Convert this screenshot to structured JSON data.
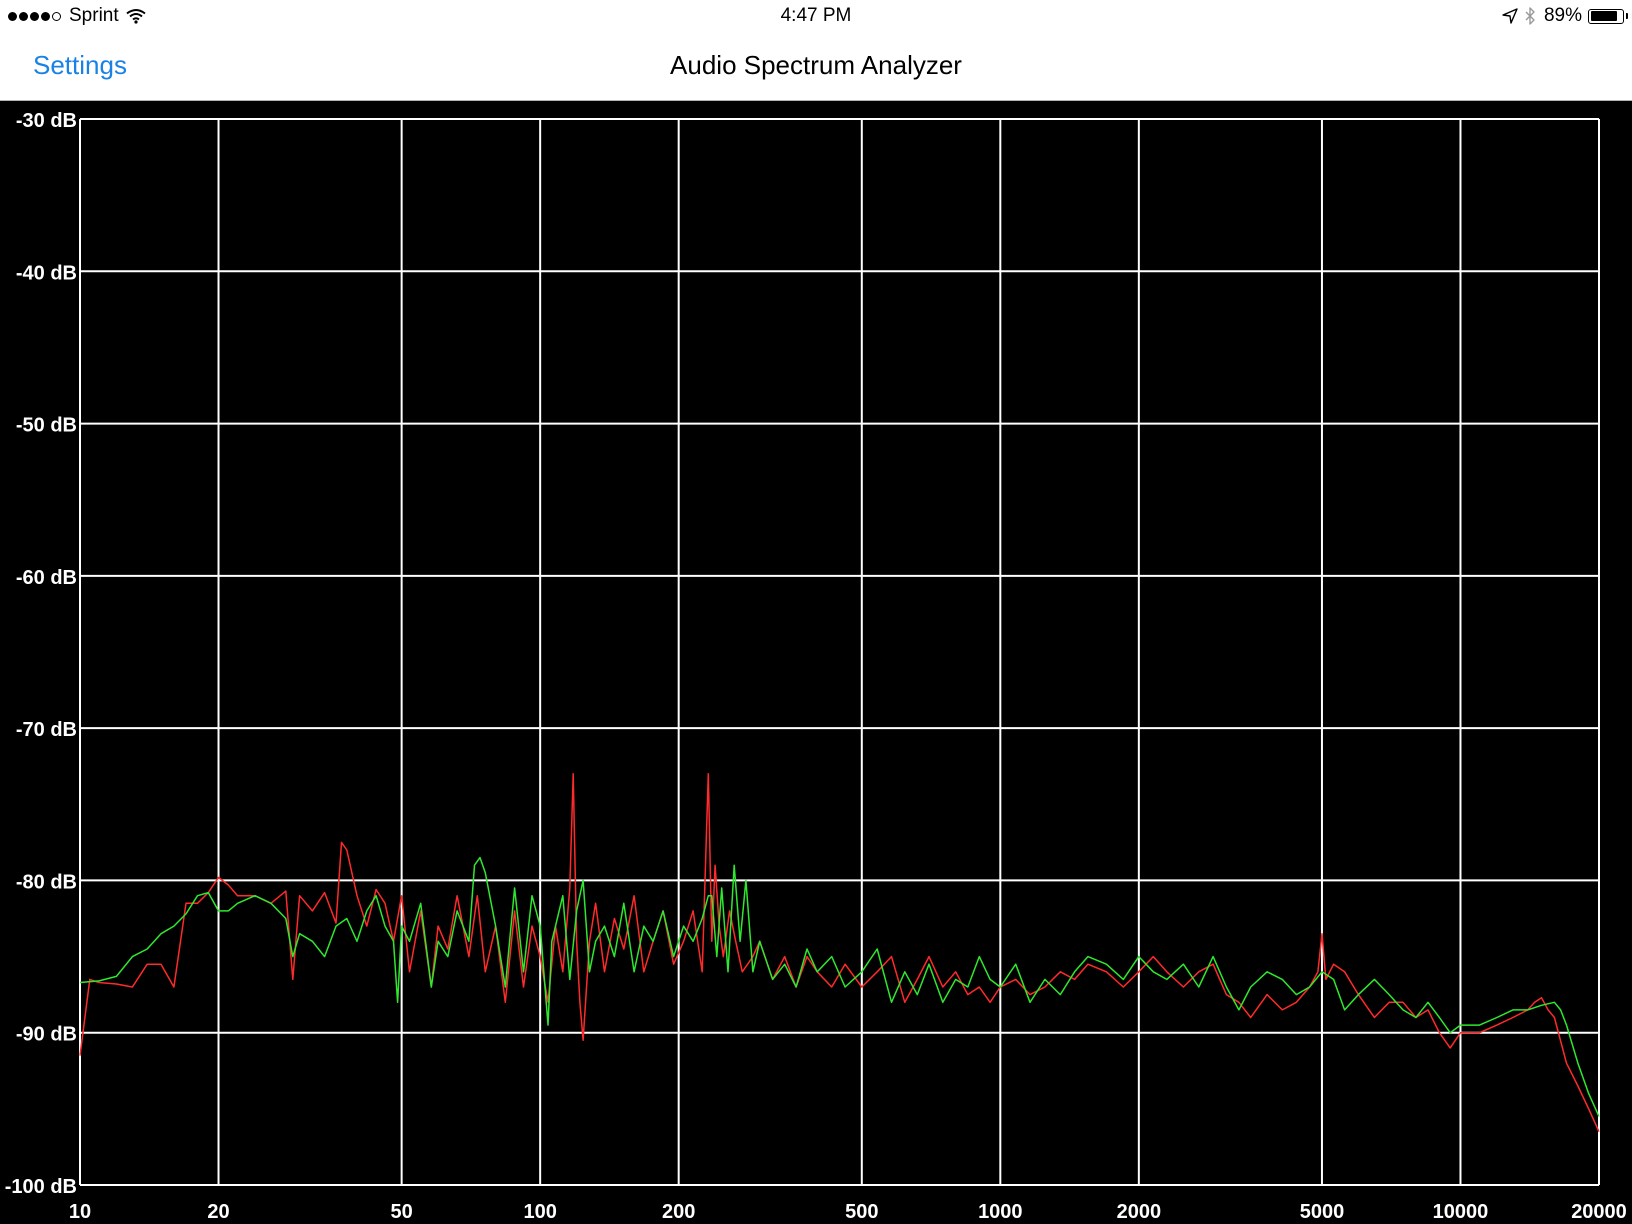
{
  "status_bar": {
    "signal_bars_filled": 4,
    "signal_bars_total": 5,
    "carrier": "Sprint",
    "wifi_icon": "wifi-icon",
    "time": "4:47 PM",
    "location_icon": "location-arrow-icon",
    "bluetooth_icon": "bluetooth-icon",
    "battery_percent": "89%",
    "battery_level": 0.89
  },
  "nav_bar": {
    "back_label": "Settings",
    "title": "Audio Spectrum Analyzer",
    "accent_color": "#1a82e6"
  },
  "chart_data": {
    "type": "line",
    "xscale": "log",
    "xlim": [
      10,
      20000
    ],
    "ylim": [
      -100,
      -30
    ],
    "grid": true,
    "background": "#000000",
    "grid_color": "#ffffff",
    "x_ticks": [
      10,
      20,
      50,
      100,
      200,
      500,
      1000,
      2000,
      5000,
      10000,
      20000
    ],
    "x_tick_labels": [
      "10",
      "20",
      "50",
      "100",
      "200",
      "500",
      "1000",
      "2000",
      "5000",
      "10000",
      "20000"
    ],
    "y_ticks": [
      -30,
      -40,
      -50,
      -60,
      -70,
      -80,
      -90,
      -100
    ],
    "y_tick_labels": [
      "-30 dB",
      "-40 dB",
      "-50 dB",
      "-60 dB",
      "-70 dB",
      "-80 dB",
      "-90 dB",
      "-100 dB"
    ],
    "series": [
      {
        "color": "#ff2a2a",
        "x": [
          10,
          10.5,
          11,
          12,
          13,
          14,
          15,
          16,
          17,
          18,
          19,
          20,
          21,
          22,
          24,
          26,
          28,
          29,
          30,
          32,
          34,
          36,
          37,
          38,
          40,
          42,
          44,
          46,
          48,
          50,
          52,
          55,
          58,
          60,
          63,
          66,
          70,
          73,
          76,
          80,
          84,
          88,
          92,
          96,
          100,
          104,
          108,
          112,
          116,
          118,
          120,
          122,
          124,
          128,
          132,
          138,
          145,
          152,
          160,
          168,
          176,
          185,
          195,
          205,
          215,
          225,
          232,
          236,
          240,
          245,
          250,
          258,
          266,
          275,
          290,
          300,
          320,
          340,
          360,
          380,
          400,
          430,
          460,
          500,
          540,
          580,
          620,
          660,
          700,
          750,
          800,
          850,
          900,
          950,
          1000,
          1080,
          1160,
          1250,
          1350,
          1450,
          1550,
          1700,
          1850,
          2000,
          2150,
          2300,
          2500,
          2700,
          2900,
          3100,
          3300,
          3500,
          3800,
          4100,
          4400,
          4700,
          4900,
          5000,
          5100,
          5300,
          5600,
          6000,
          6500,
          7000,
          7500,
          8000,
          8500,
          9000,
          9500,
          10000,
          11000,
          12000,
          13000,
          14000,
          14500,
          15000,
          15500,
          16000,
          17000,
          18000,
          19000,
          20000
        ],
        "y": [
          -91.5,
          -86.5,
          -86.7,
          -86.8,
          -87,
          -85.5,
          -85.5,
          -87,
          -81.5,
          -81.5,
          -80.8,
          -79.8,
          -80.3,
          -81,
          -81,
          -81.5,
          -80.7,
          -86.5,
          -81,
          -82,
          -80.8,
          -82.8,
          -77.5,
          -78,
          -81,
          -83,
          -80.6,
          -81.5,
          -84,
          -81,
          -86,
          -82,
          -87,
          -83,
          -84.5,
          -81,
          -85,
          -81,
          -86,
          -83,
          -88,
          -82,
          -87,
          -83,
          -85,
          -88,
          -83,
          -86,
          -80.5,
          -73,
          -84,
          -88,
          -90.5,
          -84,
          -81.5,
          -86,
          -82.5,
          -84.5,
          -81,
          -86,
          -84,
          -82,
          -85.5,
          -84,
          -82,
          -86,
          -73,
          -84,
          -79,
          -83,
          -85,
          -82,
          -84,
          -86,
          -85,
          -84,
          -86.5,
          -85,
          -87,
          -85,
          -86,
          -87,
          -85.5,
          -87,
          -86,
          -85,
          -88,
          -86.5,
          -85,
          -87,
          -86,
          -87.5,
          -87,
          -88,
          -87,
          -86.5,
          -87.5,
          -87,
          -86,
          -86.5,
          -85.5,
          -86,
          -87,
          -86,
          -85,
          -86,
          -87,
          -86,
          -85.5,
          -87.5,
          -88,
          -89,
          -87.5,
          -88.5,
          -88,
          -87,
          -86,
          -83.5,
          -86.5,
          -85.5,
          -86,
          -87.5,
          -89,
          -88,
          -88,
          -89,
          -88.5,
          -90,
          -91,
          -90,
          -90,
          -89.5,
          -89,
          -88.5,
          -88,
          -87.7,
          -88.5,
          -89,
          -92,
          -93.5,
          -95,
          -96.5
        ]
      },
      {
        "color": "#2ee82e",
        "x": [
          10,
          11,
          12,
          13,
          14,
          15,
          16,
          17,
          18,
          19,
          20,
          21,
          22,
          24,
          26,
          28,
          29,
          30,
          32,
          34,
          36,
          38,
          40,
          42,
          44,
          46,
          48,
          49,
          50,
          52,
          55,
          58,
          60,
          63,
          66,
          70,
          72,
          74,
          76,
          80,
          84,
          88,
          92,
          96,
          100,
          104,
          106,
          108,
          112,
          116,
          120,
          124,
          128,
          132,
          138,
          145,
          152,
          160,
          168,
          176,
          185,
          195,
          205,
          215,
          225,
          232,
          236,
          242,
          248,
          256,
          264,
          272,
          280,
          290,
          300,
          320,
          340,
          360,
          380,
          400,
          430,
          460,
          500,
          540,
          580,
          620,
          660,
          700,
          750,
          800,
          850,
          900,
          950,
          1000,
          1080,
          1160,
          1250,
          1350,
          1450,
          1550,
          1700,
          1850,
          2000,
          2150,
          2300,
          2500,
          2700,
          2900,
          3100,
          3300,
          3500,
          3800,
          4100,
          4400,
          4700,
          5000,
          5300,
          5600,
          6000,
          6500,
          7000,
          7500,
          8000,
          8500,
          9000,
          9500,
          10000,
          11000,
          12000,
          13000,
          14000,
          15000,
          16000,
          16500,
          17000,
          18000,
          19000,
          20000
        ],
        "y": [
          -86.7,
          -86.6,
          -86.3,
          -85,
          -84.5,
          -83.5,
          -83,
          -82.2,
          -81,
          -80.8,
          -82,
          -82,
          -81.5,
          -81,
          -81.5,
          -82.5,
          -85,
          -83.5,
          -84,
          -85,
          -83,
          -82.5,
          -84,
          -82,
          -81,
          -83,
          -84,
          -88,
          -83,
          -84,
          -81.5,
          -87,
          -84,
          -85,
          -82,
          -84,
          -79,
          -78.5,
          -79.5,
          -83,
          -87,
          -80.5,
          -86,
          -81,
          -83,
          -89.5,
          -84,
          -83,
          -81,
          -86.5,
          -82,
          -80,
          -86,
          -84,
          -83,
          -85,
          -81.5,
          -86,
          -83,
          -84,
          -82,
          -85,
          -83,
          -84,
          -82.5,
          -81,
          -81,
          -85,
          -80.5,
          -86,
          -79,
          -84,
          -80,
          -86,
          -84,
          -86.5,
          -85.5,
          -87,
          -84.5,
          -86,
          -85,
          -87,
          -86,
          -84.5,
          -88,
          -86,
          -87.5,
          -85.5,
          -88,
          -86.5,
          -87,
          -85,
          -86.5,
          -87,
          -85.5,
          -88,
          -86.5,
          -87.5,
          -86,
          -85,
          -85.5,
          -86.5,
          -85,
          -86,
          -86.5,
          -85.5,
          -87,
          -85,
          -87,
          -88.5,
          -87,
          -86,
          -86.5,
          -87.5,
          -87,
          -86,
          -86.5,
          -88.5,
          -87.5,
          -86.5,
          -87.5,
          -88.5,
          -89,
          -88,
          -89,
          -90,
          -89.5,
          -89.5,
          -89,
          -88.5,
          -88.5,
          -88.2,
          -88,
          -88.5,
          -89.5,
          -92,
          -94,
          -95.5
        ]
      }
    ]
  }
}
